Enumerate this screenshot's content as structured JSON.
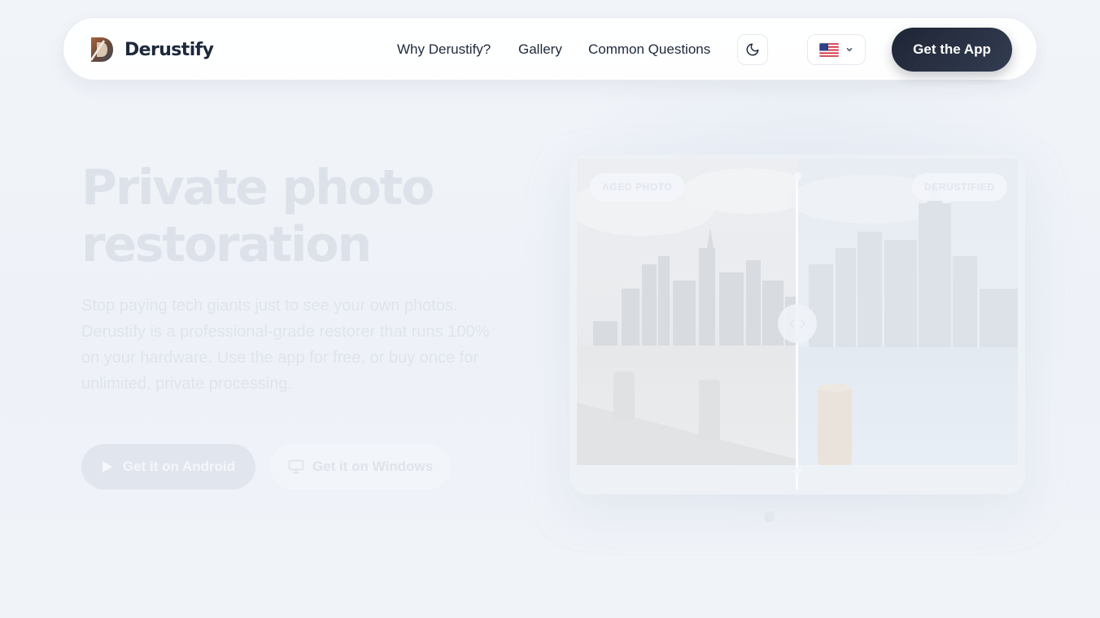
{
  "nav": {
    "brand": "Derustify",
    "links": [
      "Why Derustify?",
      "Gallery",
      "Common Questions"
    ],
    "cta": "Get the App",
    "theme_icon": "moon-icon",
    "language_icon": "us-flag-icon"
  },
  "hero": {
    "title_line1": "Private photo",
    "title_line2": "restoration",
    "subtitle": "Stop paying tech giants just to see your own photos. Derustify is a professional-grade restorer that runs 100% on your hardware. Use the app for free, or buy once for unlimited, private processing.",
    "android_button": "Get it on Android",
    "windows_button": "Get it on Windows"
  },
  "compare": {
    "before_label": "AGED PHOTO",
    "after_label": "DERUSTIFIED",
    "slide_count": 4,
    "active_slide": 1
  },
  "colors": {
    "accent_dark": "#1e2535",
    "text_dark": "#1e293b",
    "faded_text": "#dde2ea"
  }
}
